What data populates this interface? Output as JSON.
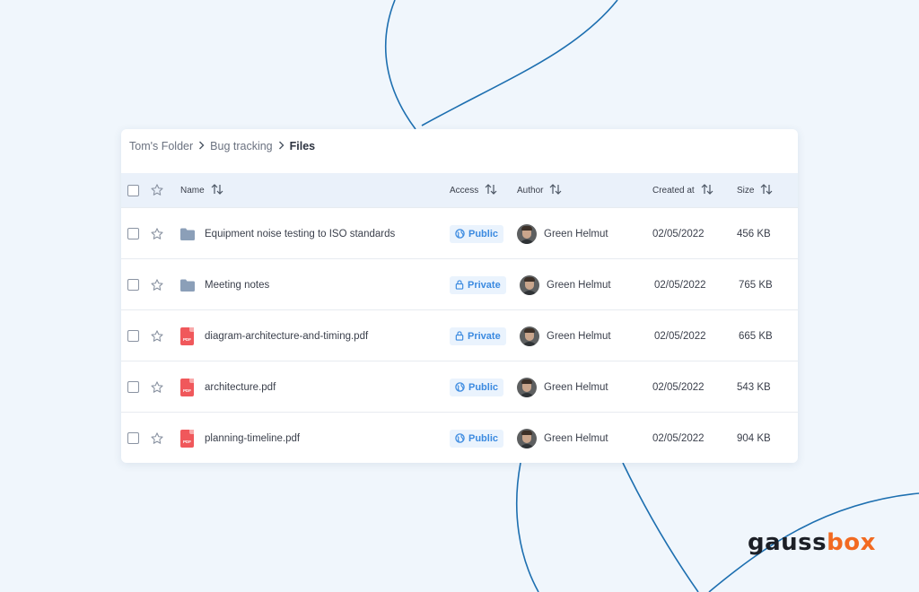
{
  "breadcrumb": {
    "items": [
      "Tom's Folder",
      "Bug tracking"
    ],
    "current": "Files"
  },
  "table": {
    "columns": {
      "name": "Name",
      "access": "Access",
      "author": "Author",
      "created": "Created at",
      "size": "Size"
    },
    "rows": [
      {
        "type": "folder",
        "name": "Equipment noise testing to ISO standards",
        "access": "Public",
        "author": "Green Helmut",
        "created": "02/05/2022",
        "size": "456 KB"
      },
      {
        "type": "folder",
        "name": "Meeting notes",
        "access": "Private",
        "author": "Green Helmut",
        "created": "02/05/2022",
        "size": "765 KB"
      },
      {
        "type": "pdf",
        "name": "diagram-architecture-and-timing.pdf",
        "access": "Private",
        "author": "Green Helmut",
        "created": "02/05/2022",
        "size": "665 KB"
      },
      {
        "type": "pdf",
        "name": "architecture.pdf",
        "access": "Public",
        "author": "Green Helmut",
        "created": "02/05/2022",
        "size": "543 KB"
      },
      {
        "type": "pdf",
        "name": "planning-timeline.pdf",
        "access": "Public",
        "author": "Green Helmut",
        "created": "02/05/2022",
        "size": "904 KB"
      }
    ],
    "pdf_icon_text": "PDF"
  },
  "icons": {
    "star": "star-icon",
    "sort": "sort-arrows-icon",
    "folder": "folder-icon",
    "pdf": "pdf-file-icon",
    "globe": "globe-icon",
    "lock": "lock-icon"
  },
  "colors": {
    "accent_blue": "#3b8ae0",
    "badge_bg": "#eaf3fd",
    "header_bg": "#eaf1fa",
    "pdf_red": "#f0585b",
    "folder_gray": "#8b9fb8",
    "logo_dark": "#1c1f26",
    "logo_orange": "#f26a21"
  },
  "logo": {
    "part1": "gauss",
    "part2": "box"
  }
}
